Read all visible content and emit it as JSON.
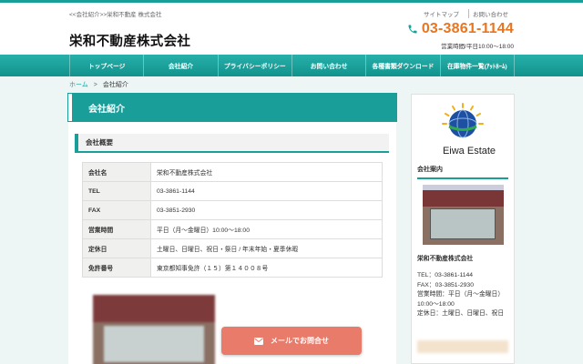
{
  "header": {
    "crumbtop": "<<会社紹介>>栄和不動産 株式会社",
    "title": "栄和不動産株式会社",
    "toplinks": [
      "サイトマップ",
      "お問い合わせ"
    ],
    "phone": "03-3861-1144",
    "hours": "営業時間/平日10:00〜18:00"
  },
  "nav": {
    "items": [
      "トップページ",
      "会社紹介",
      "プライバシーポリシー",
      "お問い合わせ",
      "各種書類ダウンロード",
      "在庫物件一覧(ｱｯﾄﾎｰﾑ)"
    ]
  },
  "breadcrumb": {
    "home": "ホーム",
    "sep": ">",
    "current": "会社紹介"
  },
  "main": {
    "page_title": "会社紹介",
    "section_title": "会社概要",
    "table": [
      {
        "key": "会社名",
        "value": "栄和不動産株式会社"
      },
      {
        "key": "TEL",
        "value": "03-3861-1144"
      },
      {
        "key": "FAX",
        "value": "03-3851-2930"
      },
      {
        "key": "営業時間",
        "value": "平日（月〜金曜日）10:00〜18:00"
      },
      {
        "key": "定休日",
        "value": "土曜日、日曜日、祝日・祭日 / 年末年始・夏季休暇"
      },
      {
        "key": "免許番号",
        "value": "東京都知事免許（１５）第１４００８号"
      }
    ]
  },
  "side": {
    "logo_text": "Eiwa Estate",
    "heading": "会社案内",
    "name": "栄和不動産株式会社",
    "lines": [
      "TEL：03-3861-1144",
      "FAX：03-3851-2930",
      "営業時間：平日（月〜金曜日）",
      "10:00〜18:00",
      "定休日：土曜日、日曜日、祝日"
    ]
  },
  "mail_button": "メールでお問合せ",
  "colors": {
    "accent": "#1a9e9a",
    "phone": "#e9751f",
    "mail": "#e97b6a"
  }
}
